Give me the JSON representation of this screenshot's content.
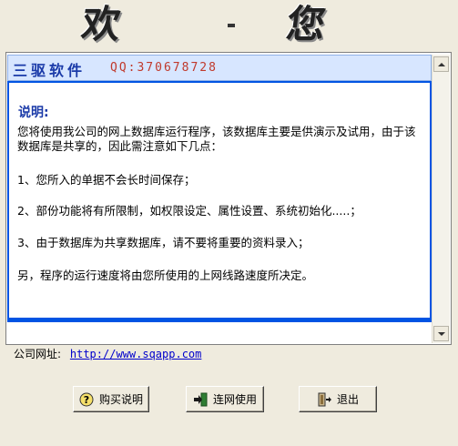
{
  "banner": {
    "chars": [
      "欢",
      "·",
      "您"
    ]
  },
  "header": {
    "company": "三驱软件",
    "qq": "QQ:370678728"
  },
  "content": {
    "title": "说明:",
    "paragraphs": [
      "您将使用我公司的网上数据库运行程序，该数据库主要是供演示及试用，由于该数据库是共享的，因此需注意如下几点：",
      "1、您所入的单据不会长时间保存；",
      "2、部份功能将有所限制，如权限设定、属性设置、系统初始化.....；",
      "3、由于数据库为共享数据库，请不要将重要的资料录入；",
      "另，程序的运行速度将由您所使用的上网线路速度所决定。"
    ]
  },
  "footer": {
    "website_label": "公司网址:",
    "website_url": "http://www.sqapp.com"
  },
  "buttons": {
    "purchase": "购买说明",
    "online": "连网使用",
    "exit": "退出"
  },
  "colors": {
    "header_text": "#1a3aa8",
    "qq_text": "#c0392b",
    "frame": "#0054e3"
  }
}
